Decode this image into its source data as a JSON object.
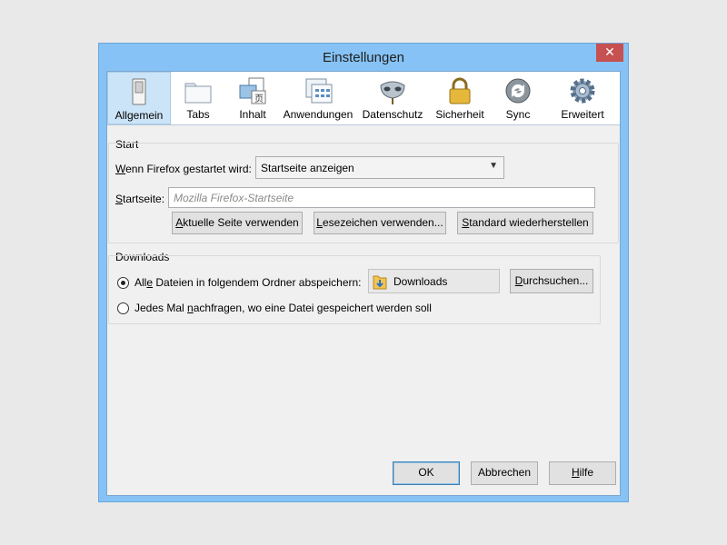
{
  "window": {
    "title": "Einstellungen",
    "close": "✕"
  },
  "toolbar": {
    "panes": [
      {
        "label": "Allgemein",
        "icon": "switch-icon",
        "selected": true
      },
      {
        "label": "Tabs",
        "icon": "tabs-icon"
      },
      {
        "label": "Inhalt",
        "icon": "content-icon"
      },
      {
        "label": "Anwendungen",
        "icon": "applications-icon"
      },
      {
        "label": "Datenschutz",
        "icon": "mask-icon"
      },
      {
        "label": "Sicherheit",
        "icon": "lock-icon"
      },
      {
        "label": "Sync",
        "icon": "sync-icon"
      },
      {
        "label": "Erweitert",
        "icon": "gear-icon"
      }
    ]
  },
  "start": {
    "group_label": "Start",
    "when_label_pre": "W",
    "when_label_rest": "enn Firefox gestartet wird:",
    "startup_select": "Startseite anzeigen",
    "homepage_label_pre": "S",
    "homepage_label_rest": "tartseite:",
    "homepage_placeholder": "Mozilla Firefox-Startseite",
    "btn_current_pre": "A",
    "btn_current_rest": "ktuelle Seite verwenden",
    "btn_bookmark_pre": "L",
    "btn_bookmark_rest": "esezeichen verwenden...",
    "btn_restore_pre": "S",
    "btn_restore_rest": "tandard wiederherstellen"
  },
  "downloads": {
    "group_label": "Downloads",
    "save_label_a": "All",
    "save_label_u": "e",
    "save_label_b": " Dateien in folgendem Ordner abspeichern:",
    "folder": "Downloads",
    "browse_pre": "D",
    "browse_rest": "urchsuchen...",
    "ask_label_a": "Jedes Mal ",
    "ask_label_u": "n",
    "ask_label_b": "achfragen, wo eine Datei gespeichert werden soll"
  },
  "footer": {
    "ok": "OK",
    "cancel": "Abbrechen",
    "help_pre": "H",
    "help_rest": "ilfe"
  },
  "colors": {
    "selected_pane": "#cce4f7",
    "titlebar": "#86c2f5",
    "close": "#c75050"
  }
}
